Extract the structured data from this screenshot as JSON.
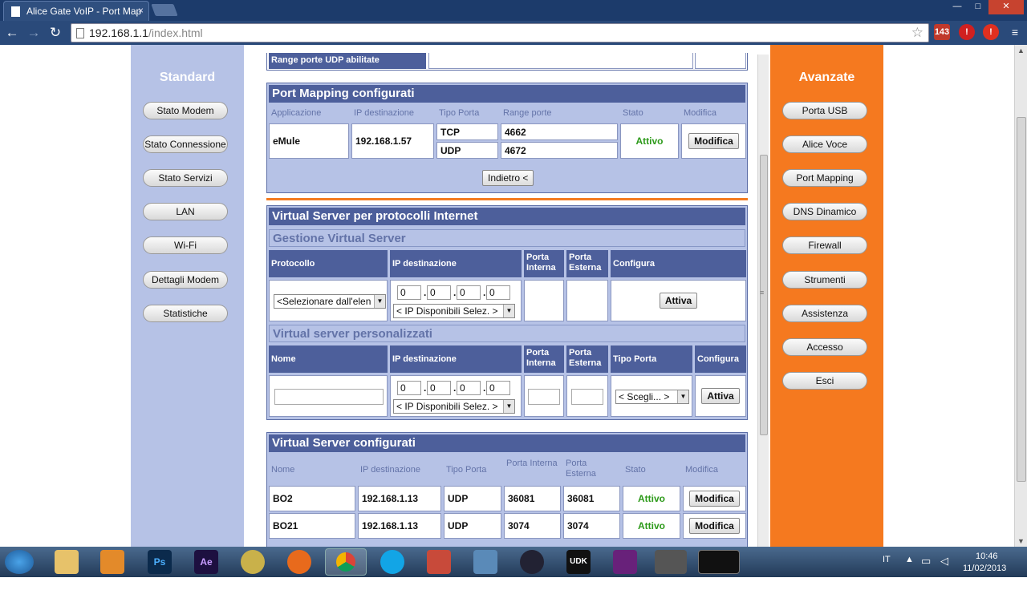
{
  "browser": {
    "tab_title": "Alice Gate VoIP - Port Map",
    "tab_close": "×",
    "url_host": "192.168.1.1",
    "url_path": "/index.html",
    "star": "☆",
    "back": "←",
    "forward": "→",
    "reload": "↻",
    "window_min": "—",
    "window_max": "□",
    "window_close": "✕",
    "ext_badges": [
      "143",
      "!",
      "!",
      "≡"
    ]
  },
  "left_nav": {
    "title": "Standard",
    "items": [
      "Stato Modem",
      "Stato Connessione",
      "Stato Servizi",
      "LAN",
      "Wi-Fi",
      "Dettagli Modem",
      "Statistiche"
    ]
  },
  "right_nav": {
    "title": "Avanzate",
    "items": [
      "Porta USB",
      "Alice Voce",
      "Port Mapping",
      "DNS Dinamico",
      "Firewall",
      "Strumenti",
      "Assistenza",
      "Accesso",
      "Esci"
    ]
  },
  "top_fragment": {
    "label": "Range porte UDP abilitate"
  },
  "port_mapping": {
    "title": "Port Mapping configurati",
    "headers": [
      "Applicazione",
      "IP destinazione",
      "Tipo Porta",
      "Range porte",
      "Stato",
      "Modifica"
    ],
    "row": {
      "app": "eMule",
      "ip": "192.168.1.57",
      "types": [
        "TCP",
        "UDP"
      ],
      "ranges": [
        "4662",
        "4672"
      ],
      "status": "Attivo",
      "modify": "Modifica"
    },
    "back_button": "Indietro <"
  },
  "virtual_server": {
    "title": "Virtual Server per protocolli Internet",
    "gestione": {
      "subtitle": "Gestione Virtual Server",
      "headers": [
        "Protocollo",
        "IP destinazione",
        "Porta Interna",
        "Porta Esterna",
        "Configura"
      ],
      "protocol_select": "<Selezionare dall'elen",
      "ip": [
        "0",
        "0",
        "0",
        "0"
      ],
      "ip_select": "< IP Disponibili Selez. >",
      "button": "Attiva"
    },
    "personalizzati": {
      "subtitle": "Virtual server personalizzati",
      "headers": [
        "Nome",
        "IP destinazione",
        "Porta Interna",
        "Porta Esterna",
        "Tipo Porta",
        "Configura"
      ],
      "ip": [
        "0",
        "0",
        "0",
        "0"
      ],
      "ip_select": "< IP Disponibili Selez. >",
      "type_select": "< Scegli... >",
      "button": "Attiva"
    }
  },
  "configured": {
    "title": "Virtual Server configurati",
    "headers": [
      "Nome",
      "IP destinazione",
      "Tipo Porta",
      "Porta Interna",
      "Porta Esterna",
      "Stato",
      "Modifica"
    ],
    "rows": [
      {
        "name": "BO2",
        "ip": "192.168.1.13",
        "type": "UDP",
        "int": "36081",
        "ext": "36081",
        "status": "Attivo",
        "modify": "Modifica"
      },
      {
        "name": "BO21",
        "ip": "192.168.1.13",
        "type": "UDP",
        "int": "3074",
        "ext": "3074",
        "status": "Attivo",
        "modify": "Modifica"
      }
    ]
  },
  "taskbar": {
    "apps": [
      "",
      "",
      "",
      "Ps",
      "Ae",
      "",
      "",
      "",
      "",
      "",
      "",
      "",
      "UDK",
      "",
      "",
      ""
    ],
    "lang": "IT",
    "time": "10:46",
    "date": "11/02/2013"
  },
  "colors": {
    "header_blue": "#4d5f9b",
    "panel_blue": "#b6c2e6",
    "orange": "#f5791f",
    "status_green": "#2d9a1a"
  }
}
